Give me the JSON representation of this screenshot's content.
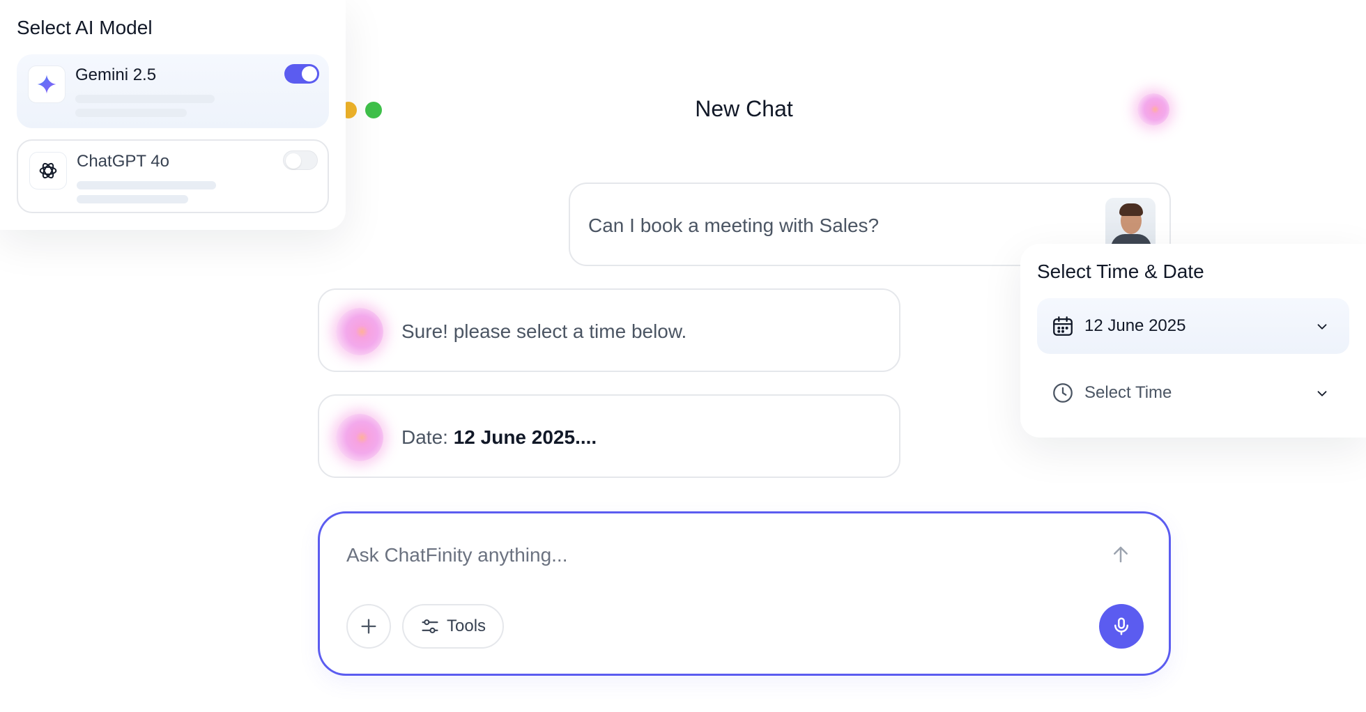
{
  "model_selector": {
    "title": "Select AI Model",
    "models": [
      {
        "name": "Gemini 2.5",
        "icon": "gemini-sparkle-icon",
        "enabled": true
      },
      {
        "name": "ChatGPT 4o",
        "icon": "openai-icon",
        "enabled": false
      }
    ]
  },
  "chat": {
    "title": "New Chat",
    "messages": [
      {
        "role": "user",
        "text": "Can I book a meeting with Sales?"
      },
      {
        "role": "assistant",
        "text": "Sure! please select a time below."
      },
      {
        "role": "assistant",
        "label": "Date:",
        "value": "12 June 2025...."
      }
    ]
  },
  "composer": {
    "placeholder": "Ask ChatFinity anything...",
    "tools_label": "Tools"
  },
  "time_picker": {
    "title": "Select Time & Date",
    "date_value": "12 June 2025",
    "time_placeholder": "Select Time"
  },
  "colors": {
    "accent": "#5b5cf0",
    "traffic_yellow": "#f0b429",
    "traffic_green": "#3fc04a"
  }
}
